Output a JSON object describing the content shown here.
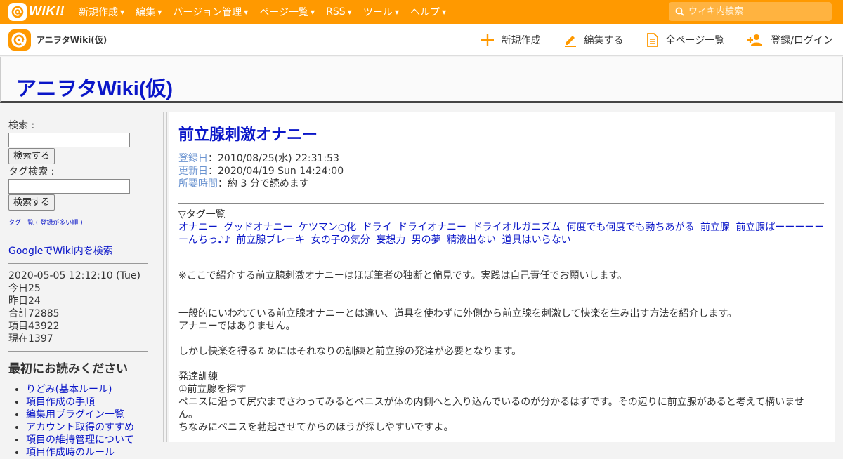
{
  "topbar": {
    "logo_text": "WIKI!",
    "menu": [
      "新規作成",
      "編集",
      "バージョン管理",
      "ページ一覧",
      "RSS",
      "ツール",
      "ヘルプ"
    ],
    "search_placeholder": "ウィキ内検索",
    "color": "#ff9900"
  },
  "secbar": {
    "site_name": "アニヲタWiki(仮)",
    "nav": [
      {
        "label": "新規作成",
        "icon": "plus-icon"
      },
      {
        "label": "編集する",
        "icon": "pencil-icon"
      },
      {
        "label": "全ページ一覧",
        "icon": "document-icon"
      },
      {
        "label": "登録/ログイン",
        "icon": "add-user-icon"
      }
    ]
  },
  "wiki": {
    "title": "アニヲタWiki(仮)",
    "title_color": "#0a16c8"
  },
  "sidebar": {
    "search_label": "検索 :",
    "search_button": "検索する",
    "tag_search_label": "タグ検索 :",
    "tag_search_button": "検索する",
    "tag_list_link": "タグ一覧",
    "tag_list_paren_open": " ( ",
    "tag_popular_link": "登録が多い順",
    "tag_list_paren_close": " )",
    "google_link": "GoogleでWiki内を検索",
    "counter": {
      "datetime": "2020-05-05 12:12:10 (Tue)",
      "today": "今日25",
      "yesterday": "昨日24",
      "total": "合計72885",
      "items": "項目43922",
      "now": "現在1397"
    },
    "read_first_heading": "最初にお読みください",
    "read_first_items": [
      "りどみ(基本ルール)",
      "項目作成の手順",
      "編集用プラグイン一覧",
      "アカウント取得のすすめ",
      "項目の維持管理について",
      "項目作成時のルール"
    ]
  },
  "page": {
    "title": "前立腺刺激オナニー",
    "registered_label": "登録日",
    "registered_value": "：2010/08/25(水) 22:31:53",
    "updated_label": "更新日",
    "updated_value": "：2020/04/19 Sun 14:24:00",
    "readtime_label": "所要時間",
    "readtime_value": "：約 3 分で読めます",
    "tags_label": "▽タグ一覧",
    "tags": [
      "オナニー",
      "グッドオナニー",
      "ケツマン○化",
      "ドライ",
      "ドライオナニー",
      "ドライオルガニズム",
      "何度でも何度でも勃ちあがる",
      "前立腺",
      "前立腺ぱーーーーーーんちっ♪♪",
      "前立腺ブレーキ",
      "女の子の気分",
      "妄想力",
      "男の夢",
      "精液出ない",
      "道具はいらない"
    ],
    "paragraphs": [
      "※ここで紹介する前立腺刺激オナニーはほぼ筆者の独断と偏見です。実践は自己責任でお願いします。",
      "一般的にいわれている前立腺オナニーとは違い、道具を使わずに外側から前立腺を刺激して快楽を生み出す方法を紹介します。",
      "アナニーではありません。",
      "しかし快楽を得るためにはそれなりの訓練と前立腺の発達が必要となります。",
      "発達訓練",
      "①前立腺を探す",
      "ペニスに沿って尻穴までさわってみるとペニスが体の内側へと入り込んでいるのが分かるはずです。その辺りに前立腺があると考えて構いません。",
      "ちなみにペニスを勃起させてからのほうが探しやすいですよ。"
    ]
  }
}
